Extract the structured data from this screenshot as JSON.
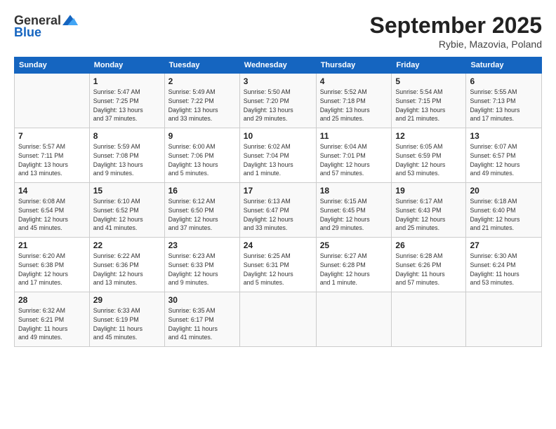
{
  "header": {
    "logo_line1": "General",
    "logo_line2": "Blue",
    "month": "September 2025",
    "location": "Rybie, Mazovia, Poland"
  },
  "weekdays": [
    "Sunday",
    "Monday",
    "Tuesday",
    "Wednesday",
    "Thursday",
    "Friday",
    "Saturday"
  ],
  "weeks": [
    [
      {
        "day": "",
        "info": ""
      },
      {
        "day": "1",
        "info": "Sunrise: 5:47 AM\nSunset: 7:25 PM\nDaylight: 13 hours\nand 37 minutes."
      },
      {
        "day": "2",
        "info": "Sunrise: 5:49 AM\nSunset: 7:22 PM\nDaylight: 13 hours\nand 33 minutes."
      },
      {
        "day": "3",
        "info": "Sunrise: 5:50 AM\nSunset: 7:20 PM\nDaylight: 13 hours\nand 29 minutes."
      },
      {
        "day": "4",
        "info": "Sunrise: 5:52 AM\nSunset: 7:18 PM\nDaylight: 13 hours\nand 25 minutes."
      },
      {
        "day": "5",
        "info": "Sunrise: 5:54 AM\nSunset: 7:15 PM\nDaylight: 13 hours\nand 21 minutes."
      },
      {
        "day": "6",
        "info": "Sunrise: 5:55 AM\nSunset: 7:13 PM\nDaylight: 13 hours\nand 17 minutes."
      }
    ],
    [
      {
        "day": "7",
        "info": "Sunrise: 5:57 AM\nSunset: 7:11 PM\nDaylight: 13 hours\nand 13 minutes."
      },
      {
        "day": "8",
        "info": "Sunrise: 5:59 AM\nSunset: 7:08 PM\nDaylight: 13 hours\nand 9 minutes."
      },
      {
        "day": "9",
        "info": "Sunrise: 6:00 AM\nSunset: 7:06 PM\nDaylight: 13 hours\nand 5 minutes."
      },
      {
        "day": "10",
        "info": "Sunrise: 6:02 AM\nSunset: 7:04 PM\nDaylight: 13 hours\nand 1 minute."
      },
      {
        "day": "11",
        "info": "Sunrise: 6:04 AM\nSunset: 7:01 PM\nDaylight: 12 hours\nand 57 minutes."
      },
      {
        "day": "12",
        "info": "Sunrise: 6:05 AM\nSunset: 6:59 PM\nDaylight: 12 hours\nand 53 minutes."
      },
      {
        "day": "13",
        "info": "Sunrise: 6:07 AM\nSunset: 6:57 PM\nDaylight: 12 hours\nand 49 minutes."
      }
    ],
    [
      {
        "day": "14",
        "info": "Sunrise: 6:08 AM\nSunset: 6:54 PM\nDaylight: 12 hours\nand 45 minutes."
      },
      {
        "day": "15",
        "info": "Sunrise: 6:10 AM\nSunset: 6:52 PM\nDaylight: 12 hours\nand 41 minutes."
      },
      {
        "day": "16",
        "info": "Sunrise: 6:12 AM\nSunset: 6:50 PM\nDaylight: 12 hours\nand 37 minutes."
      },
      {
        "day": "17",
        "info": "Sunrise: 6:13 AM\nSunset: 6:47 PM\nDaylight: 12 hours\nand 33 minutes."
      },
      {
        "day": "18",
        "info": "Sunrise: 6:15 AM\nSunset: 6:45 PM\nDaylight: 12 hours\nand 29 minutes."
      },
      {
        "day": "19",
        "info": "Sunrise: 6:17 AM\nSunset: 6:43 PM\nDaylight: 12 hours\nand 25 minutes."
      },
      {
        "day": "20",
        "info": "Sunrise: 6:18 AM\nSunset: 6:40 PM\nDaylight: 12 hours\nand 21 minutes."
      }
    ],
    [
      {
        "day": "21",
        "info": "Sunrise: 6:20 AM\nSunset: 6:38 PM\nDaylight: 12 hours\nand 17 minutes."
      },
      {
        "day": "22",
        "info": "Sunrise: 6:22 AM\nSunset: 6:36 PM\nDaylight: 12 hours\nand 13 minutes."
      },
      {
        "day": "23",
        "info": "Sunrise: 6:23 AM\nSunset: 6:33 PM\nDaylight: 12 hours\nand 9 minutes."
      },
      {
        "day": "24",
        "info": "Sunrise: 6:25 AM\nSunset: 6:31 PM\nDaylight: 12 hours\nand 5 minutes."
      },
      {
        "day": "25",
        "info": "Sunrise: 6:27 AM\nSunset: 6:28 PM\nDaylight: 12 hours\nand 1 minute."
      },
      {
        "day": "26",
        "info": "Sunrise: 6:28 AM\nSunset: 6:26 PM\nDaylight: 11 hours\nand 57 minutes."
      },
      {
        "day": "27",
        "info": "Sunrise: 6:30 AM\nSunset: 6:24 PM\nDaylight: 11 hours\nand 53 minutes."
      }
    ],
    [
      {
        "day": "28",
        "info": "Sunrise: 6:32 AM\nSunset: 6:21 PM\nDaylight: 11 hours\nand 49 minutes."
      },
      {
        "day": "29",
        "info": "Sunrise: 6:33 AM\nSunset: 6:19 PM\nDaylight: 11 hours\nand 45 minutes."
      },
      {
        "day": "30",
        "info": "Sunrise: 6:35 AM\nSunset: 6:17 PM\nDaylight: 11 hours\nand 41 minutes."
      },
      {
        "day": "",
        "info": ""
      },
      {
        "day": "",
        "info": ""
      },
      {
        "day": "",
        "info": ""
      },
      {
        "day": "",
        "info": ""
      }
    ]
  ]
}
